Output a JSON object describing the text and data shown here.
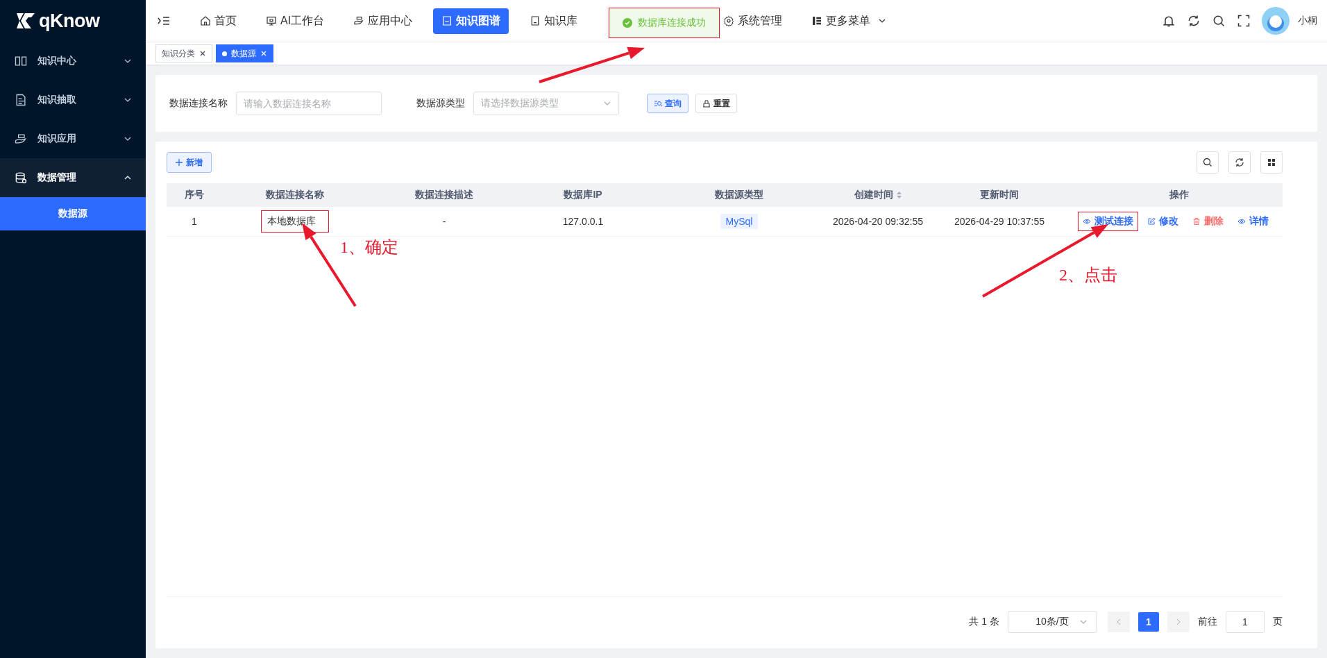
{
  "sidebar": {
    "logo": "qKnow",
    "items": [
      {
        "label": "知识中心",
        "expanded": false
      },
      {
        "label": "知识抽取",
        "expanded": false
      },
      {
        "label": "知识应用",
        "expanded": false
      },
      {
        "label": "数据管理",
        "expanded": true,
        "children": [
          {
            "label": "数据源",
            "selected": true
          }
        ]
      }
    ]
  },
  "nav": {
    "items": [
      {
        "label": "首页",
        "selected": false
      },
      {
        "label": "AI工作台",
        "selected": false
      },
      {
        "label": "应用中心",
        "selected": false
      },
      {
        "label": "知识图谱",
        "selected": true
      },
      {
        "label": "知识库",
        "selected": false
      },
      {
        "label": "系统管理",
        "selected": false
      },
      {
        "label": "更多菜单",
        "selected": false
      }
    ],
    "user": "小桐"
  },
  "toast": {
    "text": "数据库连接成功",
    "highlighted": true
  },
  "tags": [
    {
      "label": "知识分类",
      "selected": false
    },
    {
      "label": "数据源",
      "selected": true
    }
  ],
  "filter": {
    "fields": [
      {
        "label": "数据连接名称",
        "placeholder": "请输入数据连接名称",
        "kind": "input"
      },
      {
        "label": "数据源类型",
        "placeholder": "请选择数据源类型",
        "kind": "select"
      }
    ],
    "buttons": [
      {
        "label": "查询",
        "kind": "search"
      },
      {
        "label": "重置",
        "kind": "reset"
      }
    ]
  },
  "table": {
    "add_button": "新增",
    "columns": [
      {
        "label": "序号",
        "sortable": false
      },
      {
        "label": "数据连接名称",
        "sortable": false
      },
      {
        "label": "数据连接描述",
        "sortable": false
      },
      {
        "label": "数据库IP",
        "sortable": false
      },
      {
        "label": "数据源类型",
        "sortable": false
      },
      {
        "label": "创建时间",
        "sortable": true
      },
      {
        "label": "更新时间",
        "sortable": false
      },
      {
        "label": "操作",
        "sortable": false
      }
    ],
    "rows": [
      {
        "index": "1",
        "name": "本地数据库",
        "name_highlighted": true,
        "description": "-",
        "ip": "127.0.0.1",
        "type": "MySql",
        "created": "2026-04-20 09:32:55",
        "updated": "2026-04-29 10:37:55",
        "actions": [
          {
            "label": "测试连接",
            "kind": "view",
            "danger": false,
            "highlighted": true
          },
          {
            "label": "修改",
            "kind": "edit",
            "danger": false,
            "highlighted": false
          },
          {
            "label": "删除",
            "kind": "delete",
            "danger": true,
            "highlighted": false
          },
          {
            "label": "详情",
            "kind": "view",
            "danger": false,
            "highlighted": false
          }
        ]
      }
    ]
  },
  "pagination": {
    "total": "共 1 条",
    "page_size": "10条/页",
    "pages": [
      {
        "label": "1",
        "selected": true
      }
    ],
    "goto_label": "前往",
    "goto_value": "1",
    "goto_suffix": "页"
  },
  "annotations": [
    {
      "text": "1、确定"
    },
    {
      "text": "2、点击"
    }
  ]
}
